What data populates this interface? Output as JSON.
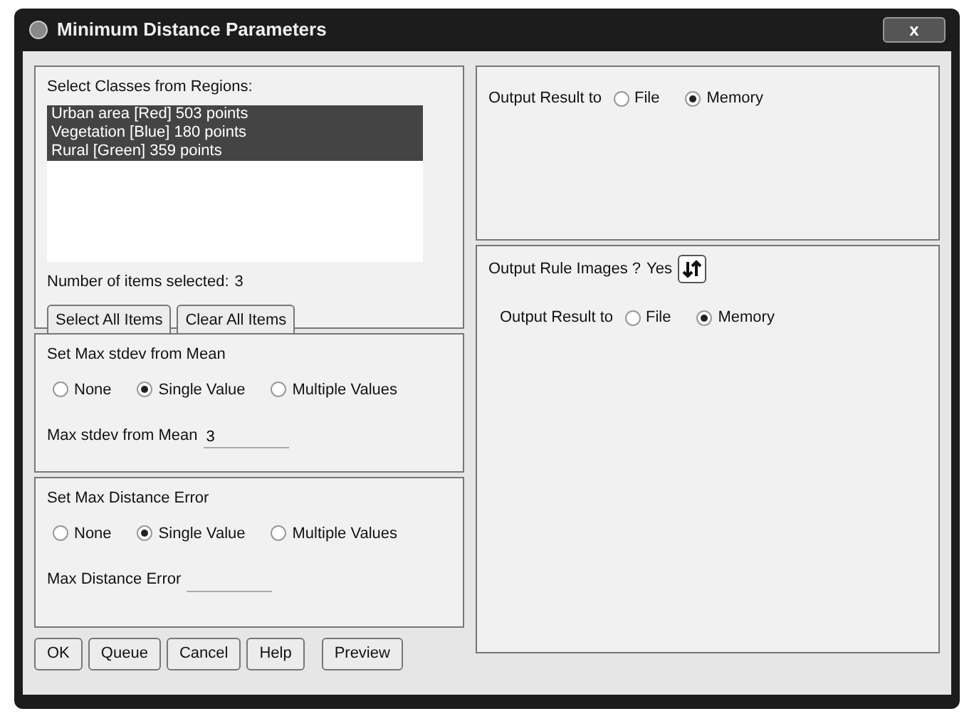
{
  "window": {
    "title": "Minimum Distance Parameters",
    "close": "x"
  },
  "classes": {
    "label": "Select Classes from Regions:",
    "items": [
      {
        "text": "Urban area [Red] 503 points",
        "selected": true
      },
      {
        "text": "Vegetation [Blue] 180 points",
        "selected": true
      },
      {
        "text": "Rural [Green] 359 points",
        "selected": true
      }
    ],
    "count_label": "Number of items selected:",
    "count": "3",
    "buttons": [
      "Select All Items",
      "Clear All Items"
    ]
  },
  "stdev": {
    "title": "Set Max stdev from Mean",
    "options": [
      {
        "label": "None",
        "selected": false
      },
      {
        "label": "Single Value",
        "selected": true
      },
      {
        "label": "Multiple Values",
        "selected": false
      }
    ],
    "field_label": "Max stdev from Mean",
    "value": "3"
  },
  "distance": {
    "title": "Set Max Distance Error",
    "options": [
      {
        "label": "None",
        "selected": false
      },
      {
        "label": "Single Value",
        "selected": true
      },
      {
        "label": "Multiple Values",
        "selected": false
      }
    ],
    "field_label": "Max Distance Error"
  },
  "output": {
    "label": "Output Result to",
    "options": [
      {
        "label": "File",
        "selected": false
      },
      {
        "label": "Memory",
        "selected": true
      }
    ]
  },
  "rule_images": {
    "label": "Output Rule Images ?",
    "value": "Yes",
    "output_label": "Output Result to",
    "options": [
      {
        "label": "File",
        "selected": false
      },
      {
        "label": "Memory",
        "selected": true
      }
    ]
  },
  "buttons": [
    "OK",
    "Queue",
    "Cancel",
    "Help"
  ],
  "preview_button": "Preview"
}
